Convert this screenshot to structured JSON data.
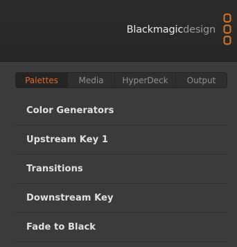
{
  "brand": {
    "name_strong": "Blackmagic",
    "name_light": "design",
    "logo_icon": "blackmagic-logo-icon",
    "accent_color": "#e2751f"
  },
  "tabs": [
    {
      "label": "Palettes",
      "active": true
    },
    {
      "label": "Media",
      "active": false
    },
    {
      "label": "HyperDeck",
      "active": false
    },
    {
      "label": "Output",
      "active": false
    }
  ],
  "palettes": [
    {
      "label": "Color Generators"
    },
    {
      "label": "Upstream Key 1"
    },
    {
      "label": "Transitions"
    },
    {
      "label": "Downstream Key"
    },
    {
      "label": "Fade to Black"
    }
  ],
  "colors": {
    "active_tab_text": "#e66424",
    "inactive_tab_text": "#8f8f8f",
    "item_text": "#e1e1e1"
  }
}
